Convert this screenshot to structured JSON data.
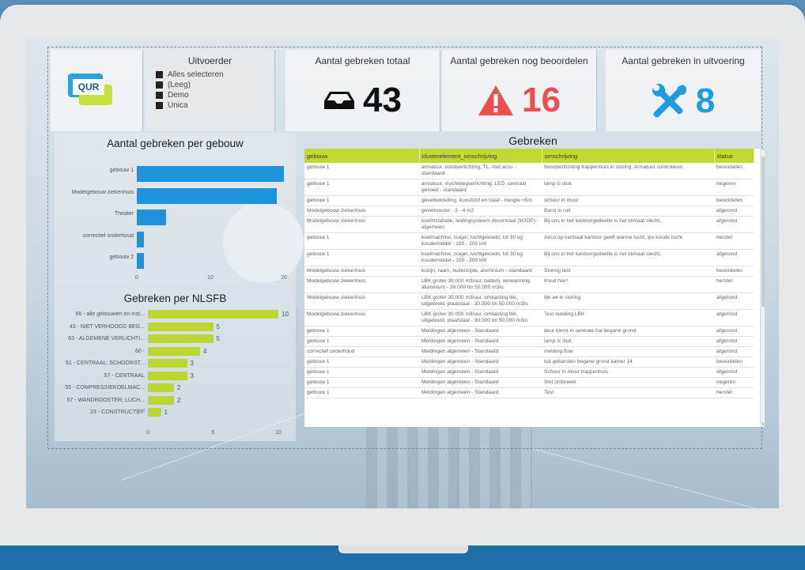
{
  "header": {
    "filter": {
      "title": "Uitvoerder",
      "options": [
        "Alles selecteren",
        "(Leeg)",
        "Demo",
        "Unica"
      ]
    },
    "logo_text": "QUR",
    "kpis": [
      {
        "title": "Aantal gebreken totaal",
        "value": "43",
        "icon": "inbox-tray-icon",
        "color": "#111111"
      },
      {
        "title": "Aantal gebreken nog beoordelen",
        "value": "16",
        "icon": "warning-triangle-icon",
        "color": "#ef4e4e"
      },
      {
        "title": "Aantal gebreken in uitvoering",
        "value": "8",
        "icon": "tools-icon",
        "color": "#1d9ce0"
      }
    ]
  },
  "chart_data": [
    {
      "type": "bar",
      "orientation": "horizontal",
      "title": "Aantal gebreken per gebouw",
      "categories": [
        "gebouw 1",
        "Modelgebouw ziekenhuis",
        "Theater",
        "correctief onderhoud",
        "gebouw 2"
      ],
      "values": [
        20,
        19,
        4,
        1,
        1
      ],
      "xlim": [
        0,
        20
      ],
      "xticks": [
        "0",
        "10",
        "20"
      ],
      "color": "#1f93da"
    },
    {
      "type": "bar",
      "orientation": "horizontal",
      "title": "Gebreken per NLSFB",
      "categories": [
        "66 - alle gebouwen en inst...",
        "43 - NIET VERHOOGD BEG...",
        "63 - ALGEMENE VERLICHTI...",
        "60 -",
        "51 - CENTRAAL; SCHOORST...",
        "57 - CENTRAAL",
        "55 - COMPRESSIEKOELMAC...",
        "57 - WANDROOSTER; LUCH...",
        "23 - CONSTRUCTIEF"
      ],
      "values": [
        10,
        5,
        5,
        4,
        3,
        3,
        2,
        2,
        1
      ],
      "xlim": [
        0,
        10
      ],
      "xticks": [
        "0",
        "5",
        "10"
      ],
      "color": "#bdd631"
    }
  ],
  "table": {
    "title": "Gebreken",
    "columns": [
      "gebouw",
      "clusterelement_omschrijving",
      "omschrijving",
      "status"
    ],
    "rows": [
      [
        "gebouw 1",
        "armatuur, noodverlichting, TL, met accu - standaard",
        "Noodverlichting trappenhuis in storing. Armatuur controleren.",
        "beoordelen"
      ],
      [
        "gebouw 1",
        "armatuur, vluchtwegverlichting, LED, centraal gevoed - standaard",
        "lamp is stuk",
        "negeren"
      ],
      [
        "gebouw 1",
        "gevelbekleding, kunststof en staal - hoogte <5m",
        "scheur in muur",
        "beoordelen"
      ],
      [
        "Modelgebouw ziekenhuis",
        "gevelrooster - 3 - 4 m2",
        "Barst in ruit",
        "afgerond"
      ],
      [
        "Modelgebouw ziekenhuis",
        "koelinstallatie, leidingsysteem decentraal (MJOP) - algemeen",
        "Bij ons in het kantoorgedeelte is het klimaat slecht.",
        "afgerond"
      ],
      [
        "gebouw 1",
        "koelmachine, zuiger, luchtgekoeld, tot 30 kg koudemiddel - 100 - 200 kW",
        "Airco op centraal kantoor geeft warme lucht, ipv koude lucht",
        "herstel"
      ],
      [
        "gebouw 1",
        "koelmachine, zuiger, luchtgekoeld, tot 30 kg koudemiddel - 100 - 200 kW",
        "Bij ons in het kantoorgedeelte is het klimaat slecht.",
        "afgerond"
      ],
      [
        "Modelgebouw ziekenhuis",
        "kozijn, raam, buitenzijde, aluminium - standaard",
        "Storing test",
        "beoordelen"
      ],
      [
        "Modelgebouw ziekenhuis",
        "LBK groter 30.000 m3/uur, batterij, verwarming, aluminium - 30.000 tm 50.000 m3/u",
        "Koud hier!",
        "herstel"
      ],
      [
        "Modelgebouw ziekenhuis",
        "LBK groter 30.000 m3/uur, omkasting lbk, uitgebreid, plaatstaal - 30.000 tm 50.000 m3/u",
        "lbk a4 in storing",
        "afgerond"
      ],
      [
        "Modelgebouw ziekenhuis",
        "LBK groter 30.000 m3/uur, omkasting lbk, uitgebreid, plaatstaal - 30.000 tm 50.000 m3/u",
        "Test melding LBK",
        "afgerond"
      ],
      [
        "gebouw 1",
        "Meldingen algemeen - Standaard",
        "deur klemt in centrale hal begane grond",
        "afgerond"
      ],
      [
        "gebouw 1",
        "Meldingen algemeen - Standaard",
        "lamp is stuk",
        "afgerond"
      ],
      [
        "correctief onderhoud",
        "Meldingen algemeen - Standaard",
        "melding flow",
        "afgerond"
      ],
      [
        "gebouw 1",
        "Meldingen algemeen - Standaard",
        "tuit gebarsten begane grond kamer 14",
        "beoordelen"
      ],
      [
        "gebouw 1",
        "Meldingen algemeen - Standaard",
        "Scheur in muur trappenhuis",
        "afgerond"
      ],
      [
        "gebouw 1",
        "Meldingen algemeen - Standaard",
        "Slot ontbreekt",
        "negeren"
      ],
      [
        "gebouw 1",
        "Meldingen algemeen - Standaard",
        "Test",
        "herstel"
      ]
    ]
  }
}
